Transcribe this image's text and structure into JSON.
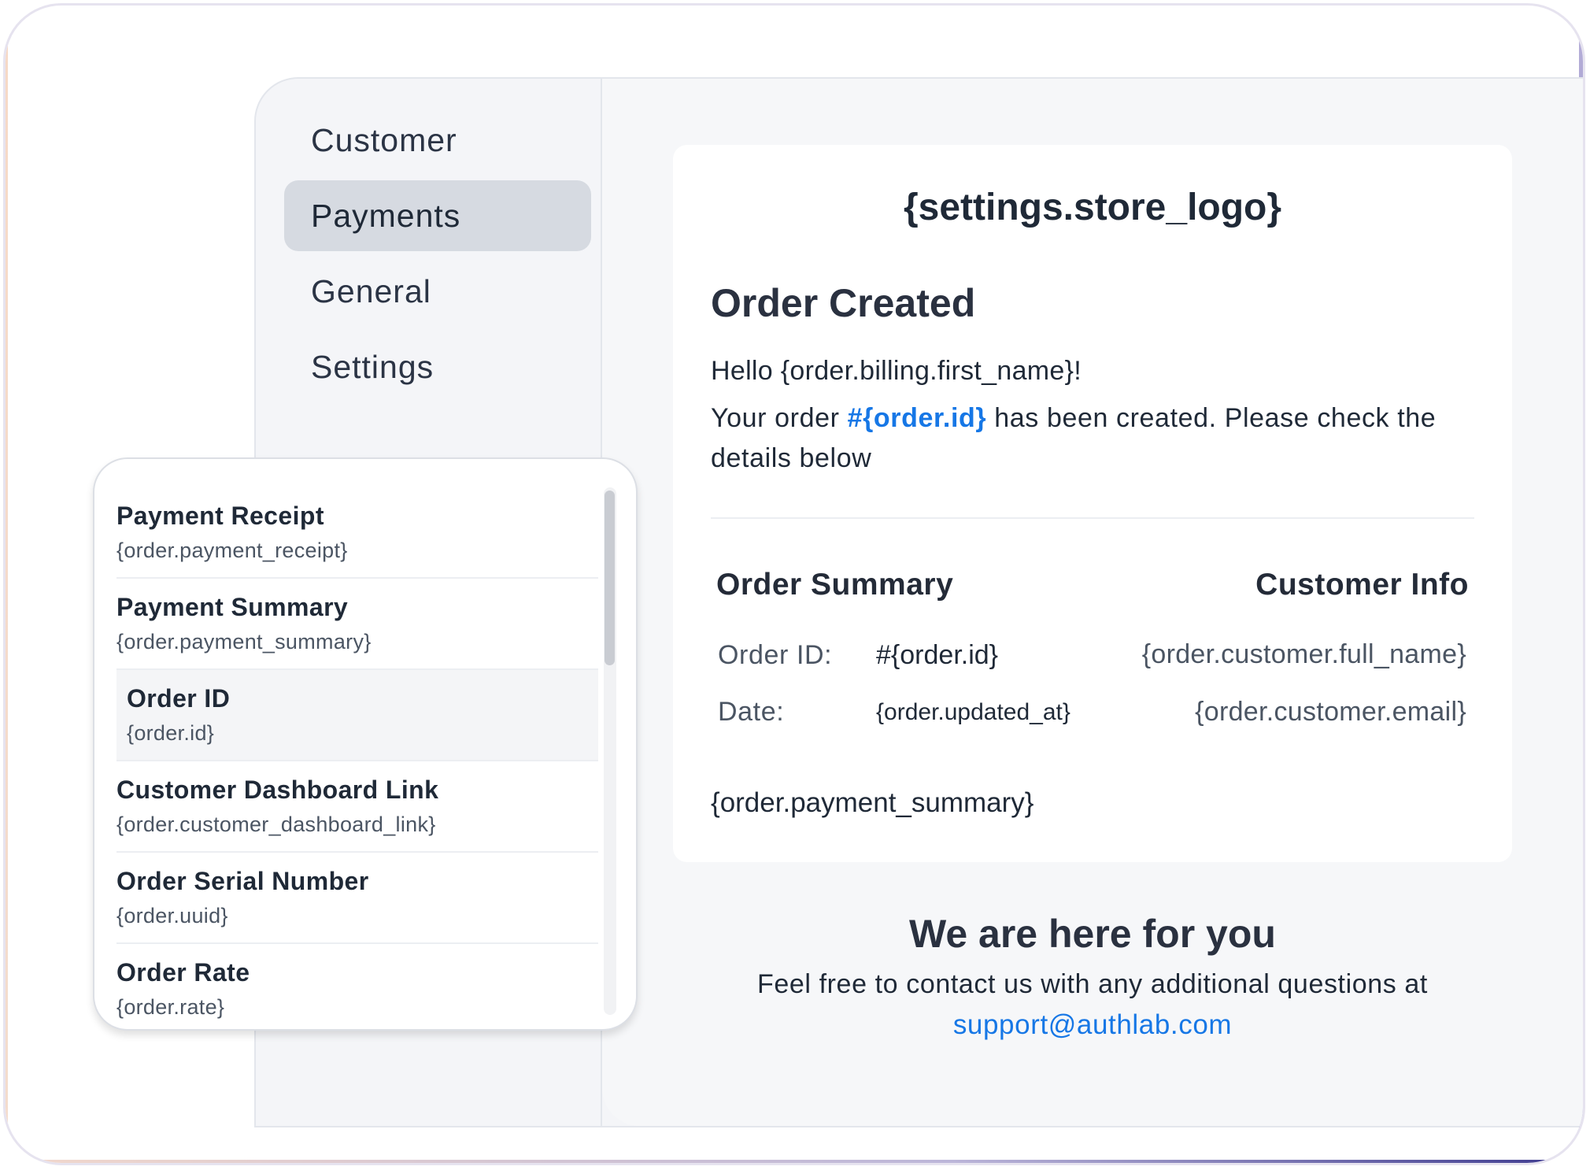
{
  "sidebar": {
    "items": [
      {
        "label": "Customer"
      },
      {
        "label": "Payments"
      },
      {
        "label": "General"
      },
      {
        "label": "Settings"
      }
    ]
  },
  "email": {
    "logo": "{settings.store_logo}",
    "title": "Order Created",
    "greeting": "Hello {order.billing.first_name}!",
    "message_before": "Your order ",
    "message_highlight": "#{order.id}",
    "message_after": " has been created. Please check the details below",
    "order_summary_heading": "Order Summary",
    "customer_info_heading": "Customer Info",
    "order_id_label": "Order ID:",
    "order_id_value": "#{order.id}",
    "date_label": "Date:",
    "date_value": "{order.updated_at}",
    "customer_name": "{order.customer.full_name}",
    "customer_email": "{order.customer.email}",
    "payment_summary": "{order.payment_summary}"
  },
  "footer": {
    "title": "We are here for you",
    "text": "Feel free to contact us with any additional questions at",
    "link": "support@authlab.com"
  },
  "dropdown": {
    "items": [
      {
        "title": "Payment Receipt",
        "code": "{order.payment_receipt}"
      },
      {
        "title": "Payment Summary",
        "code": "{order.payment_summary}"
      },
      {
        "title": "Order ID",
        "code": "{order.id}"
      },
      {
        "title": "Customer Dashboard Link",
        "code": "{order.customer_dashboard_link}"
      },
      {
        "title": "Order Serial Number",
        "code": "{order.uuid}"
      },
      {
        "title": "Order Rate",
        "code": "{order.rate}"
      }
    ]
  },
  "colors": {
    "accent_link": "#1677e6",
    "active_nav_bg": "#d6dae1",
    "frame_gradient_end": "#3d3a8f"
  }
}
